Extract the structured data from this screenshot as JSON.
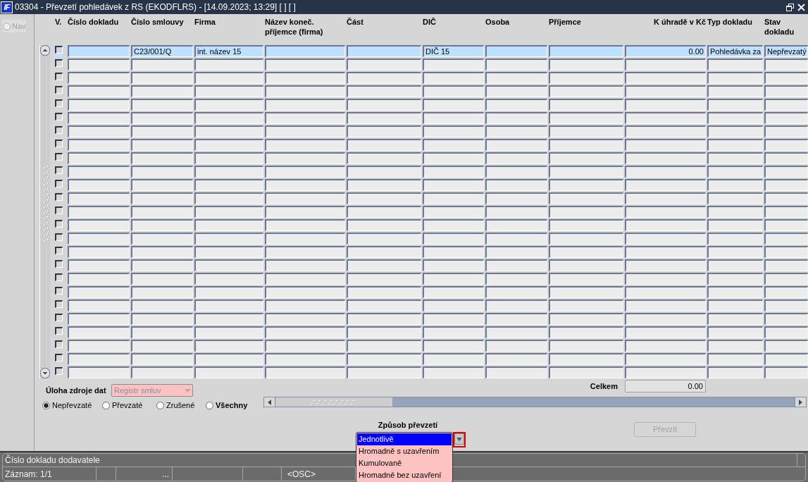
{
  "window": {
    "logo": "IF",
    "title": "03304 - Převzetí pohledávek z RS (EKODFLRS) - [14.09.2023; 13:29] [ ] [ ]"
  },
  "nav": {
    "label": "Nav",
    "disabled": true
  },
  "table": {
    "columns": [
      {
        "label": "V.",
        "kind": "check"
      },
      {
        "label": "Číslo dokladu",
        "kind": "text"
      },
      {
        "label": "Číslo smlouvy",
        "kind": "text"
      },
      {
        "label": "Firma",
        "kind": "text"
      },
      {
        "label": "Název koneč. příjemce (firma)",
        "kind": "text"
      },
      {
        "label": "Část",
        "kind": "text"
      },
      {
        "label": "DIČ",
        "kind": "text"
      },
      {
        "label": "Osoba",
        "kind": "text"
      },
      {
        "label": "Příjemce",
        "kind": "text"
      },
      {
        "label": "K úhradě v Kč",
        "kind": "amount"
      },
      {
        "label": "Typ dokladu",
        "kind": "text"
      },
      {
        "label": "Stav dokladu",
        "kind": "text"
      }
    ],
    "rows": [
      {
        "selected": true,
        "checked": false,
        "cells": [
          null,
          "C23/001/Q",
          "int. název 15",
          null,
          null,
          "DIČ 15",
          null,
          null,
          "0.00",
          "Pohledávka za",
          "Nepřevzatý"
        ]
      },
      {
        "selected": false,
        "checked": false
      },
      {
        "selected": false,
        "checked": false
      },
      {
        "selected": false,
        "checked": false
      },
      {
        "selected": false,
        "checked": false
      },
      {
        "selected": false,
        "checked": false
      },
      {
        "selected": false,
        "checked": false
      },
      {
        "selected": false,
        "checked": false
      },
      {
        "selected": false,
        "checked": false
      },
      {
        "selected": false,
        "checked": false
      },
      {
        "selected": false,
        "checked": false
      },
      {
        "selected": false,
        "checked": false
      },
      {
        "selected": false,
        "checked": false
      },
      {
        "selected": false,
        "checked": false
      },
      {
        "selected": false,
        "checked": false
      },
      {
        "selected": false,
        "checked": false
      },
      {
        "selected": false,
        "checked": false
      },
      {
        "selected": false,
        "checked": false
      },
      {
        "selected": false,
        "checked": false
      },
      {
        "selected": false,
        "checked": false
      },
      {
        "selected": false,
        "checked": false
      },
      {
        "selected": false,
        "checked": false
      },
      {
        "selected": false,
        "checked": false
      },
      {
        "selected": false,
        "checked": false
      },
      {
        "selected": false,
        "checked": false
      }
    ]
  },
  "data_source": {
    "label": "Úloha zdroje dat",
    "value": "Registr smluv",
    "disabled": true
  },
  "total": {
    "label": "Celkem",
    "value": "0.00"
  },
  "filter": [
    {
      "label": "Nepřevzaté",
      "selected": true,
      "kind": "status"
    },
    {
      "label": "Převzaté",
      "selected": false,
      "kind": "status"
    },
    {
      "label": "Zrušené",
      "selected": false,
      "kind": "status"
    },
    {
      "label": "Všechny",
      "selected": false,
      "kind": "all"
    }
  ],
  "method": {
    "label": "Způsob převzetí",
    "expanded": true,
    "highlighted": true,
    "options": [
      {
        "label": "Jednotlivě",
        "selected": true
      },
      {
        "label": "Hromadně s uzavřením",
        "selected": false
      },
      {
        "label": "Kumulovaně",
        "selected": false
      },
      {
        "label": "Hromadně bez uzavření",
        "selected": false
      }
    ]
  },
  "button": {
    "label": "Převzít",
    "disabled": true
  },
  "status_bar": {
    "message": "Číslo dokladu dodavatele",
    "segments": [
      "Záznam: 1/1",
      "...",
      "<OSC>"
    ]
  }
}
